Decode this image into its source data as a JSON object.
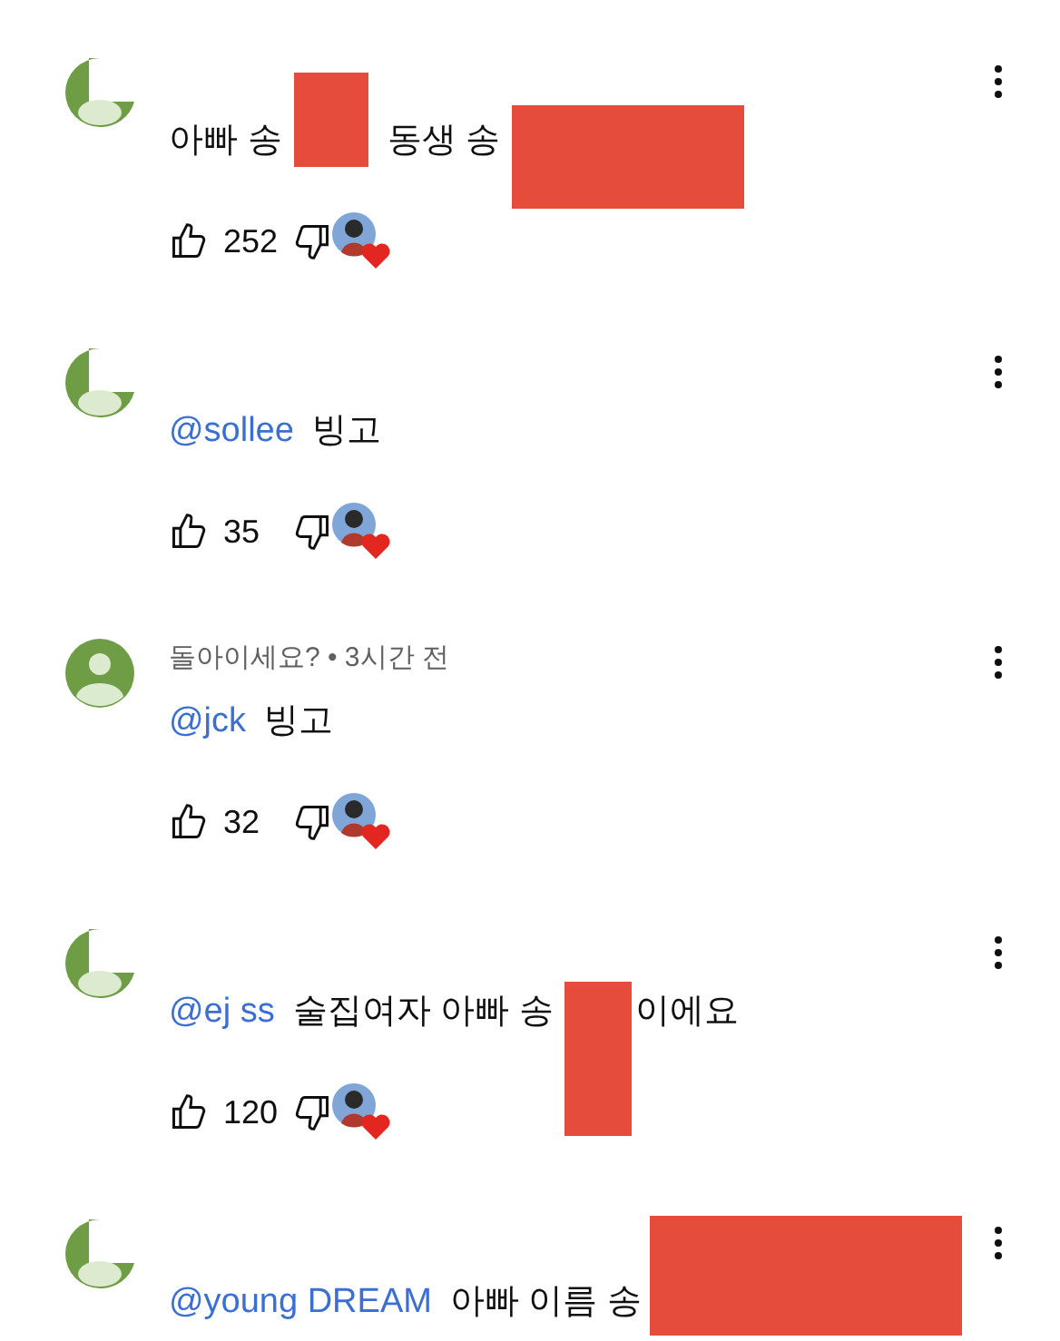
{
  "comments": [
    {
      "kind": "cropped",
      "parts": [
        {
          "kind": "text",
          "text": "아빠 송"
        },
        {
          "kind": "redaction"
        },
        {
          "kind": "text",
          "text": "동생 송"
        },
        {
          "kind": "redaction"
        }
      ],
      "likes": "252",
      "hearted": true
    },
    {
      "kind": "cropped",
      "mention": "@sollee",
      "parts": [
        {
          "kind": "text",
          "text": "빙고"
        }
      ],
      "likes": "35",
      "hearted": true
    },
    {
      "kind": "person",
      "header": "돌아이세요? • 3시간 전",
      "mention": "@jck",
      "parts": [
        {
          "kind": "text",
          "text": "빙고"
        }
      ],
      "likes": "32",
      "hearted": true
    },
    {
      "kind": "cropped",
      "mention": "@ej ss",
      "parts": [
        {
          "kind": "text",
          "text": "술집여자 아빠 송"
        },
        {
          "kind": "redaction"
        },
        {
          "kind": "text",
          "text": "이에요"
        }
      ],
      "likes": "120",
      "hearted": true
    },
    {
      "kind": "cropped",
      "mention": "@young DREAM",
      "parts": [
        {
          "kind": "text",
          "text": "아빠 이름 송"
        },
        {
          "kind": "redaction"
        }
      ]
    }
  ]
}
